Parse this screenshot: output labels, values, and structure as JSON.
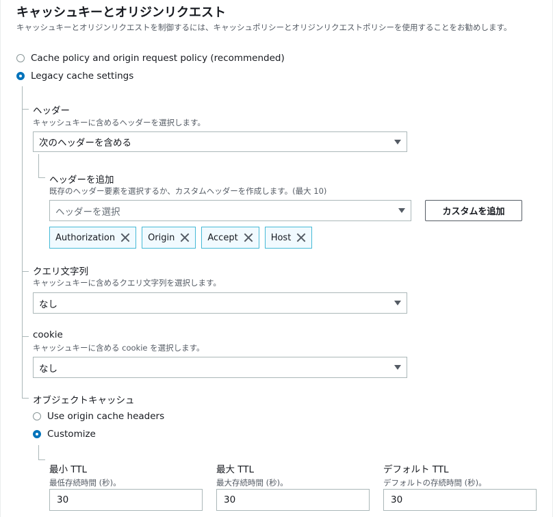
{
  "section": {
    "title": "キャッシュキーとオリジンリクエスト",
    "description": "キャッシュキーとオリジンリクエストを制御するには、キャッシュポリシーとオリジンリクエストポリシーを使用することをお勧めします。"
  },
  "mode": {
    "options": [
      {
        "label": "Cache policy and origin request policy (recommended)",
        "selected": false
      },
      {
        "label": "Legacy cache settings",
        "selected": true
      }
    ]
  },
  "headers": {
    "label": "ヘッダー",
    "description": "キャッシュキーに含めるヘッダーを選択します。",
    "selected": "次のヘッダーを含める",
    "add": {
      "label": "ヘッダーを追加",
      "description": "既存のヘッダー要素を選択するか、カスタムヘッダーを作成します。(最大 10)",
      "placeholder": "ヘッダーを選択",
      "custom_button": "カスタムを追加",
      "tokens": [
        "Authorization",
        "Origin",
        "Accept",
        "Host"
      ]
    }
  },
  "query": {
    "label": "クエリ文字列",
    "description": "キャッシュキーに含めるクエリ文字列を選択します。",
    "selected": "なし"
  },
  "cookie": {
    "label": "cookie",
    "description": "キャッシュキーに含める cookie を選択します。",
    "selected": "なし"
  },
  "object_cache": {
    "label": "オブジェクトキャッシュ",
    "options": [
      {
        "label": "Use origin cache headers",
        "selected": false
      },
      {
        "label": "Customize",
        "selected": true
      }
    ],
    "ttl": [
      {
        "label": "最小 TTL",
        "description": "最低存続時間 (秒)。",
        "value": "30"
      },
      {
        "label": "最大 TTL",
        "description": "最大存続時間 (秒)。",
        "value": "30"
      },
      {
        "label": "デフォルト TTL",
        "description": "デフォルトの存続時間 (秒)。",
        "value": "30"
      }
    ]
  },
  "colors": {
    "accent": "#0073bb",
    "token_border": "#44b9d6",
    "token_bg": "#f1faff"
  }
}
